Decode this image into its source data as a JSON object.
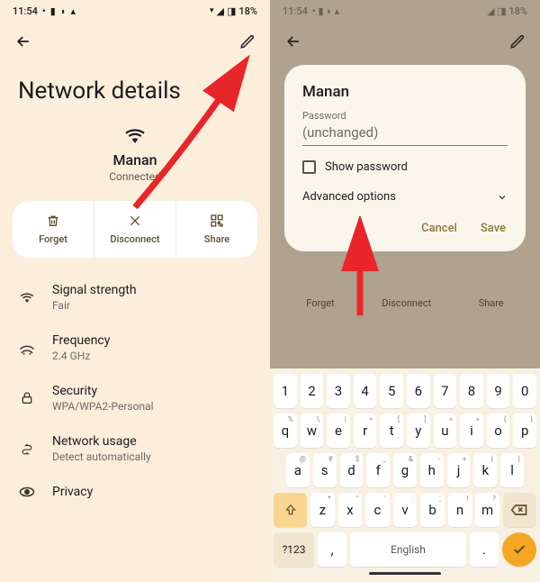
{
  "left": {
    "status": {
      "time": "11:54",
      "battery": "18%"
    },
    "title": "Network details",
    "network": {
      "name": "Manan",
      "status": "Connected"
    },
    "actions": {
      "forget": "Forget",
      "disconnect": "Disconnect",
      "share": "Share"
    },
    "rows": [
      {
        "label": "Signal strength",
        "sub": "Fair"
      },
      {
        "label": "Frequency",
        "sub": "2.4 GHz"
      },
      {
        "label": "Security",
        "sub": "WPA/WPA2-Personal"
      },
      {
        "label": "Network usage",
        "sub": "Detect automatically"
      },
      {
        "label": "Privacy",
        "sub": ""
      }
    ]
  },
  "right": {
    "dialog": {
      "name": "Manan",
      "pw_label": "Password",
      "pw_value": "(unchanged)",
      "showpw": "Show password",
      "advanced": "Advanced options",
      "cancel": "Cancel",
      "save": "Save"
    },
    "behind": {
      "forget": "Forget",
      "disconnect": "Disconnect",
      "share": "Share"
    },
    "keyboard": {
      "row1": [
        "1",
        "2",
        "3",
        "4",
        "5",
        "6",
        "7",
        "8",
        "9",
        "0"
      ],
      "row2": [
        [
          "q",
          "%"
        ],
        [
          "w",
          "\\"
        ],
        [
          "e",
          "|"
        ],
        [
          "r",
          "="
        ],
        [
          "t",
          "["
        ],
        [
          "y",
          "]"
        ],
        [
          "u",
          "<"
        ],
        [
          "i",
          ">"
        ],
        [
          "o",
          "{"
        ],
        [
          "p",
          "}"
        ]
      ],
      "row3": [
        [
          "a",
          "@"
        ],
        [
          "s",
          "#"
        ],
        [
          "d",
          "$"
        ],
        [
          "f",
          "_"
        ],
        [
          "g",
          "&"
        ],
        [
          "h",
          "-"
        ],
        [
          "j",
          "+"
        ],
        [
          "k",
          "("
        ],
        [
          "l",
          ")"
        ]
      ],
      "row4": [
        [
          "z",
          "*"
        ],
        [
          "x",
          "\""
        ],
        [
          "c",
          "'"
        ],
        [
          "v",
          ":"
        ],
        [
          "b",
          ";"
        ],
        [
          "n",
          "!"
        ],
        [
          "m",
          "?"
        ]
      ],
      "sym": "?123",
      "space": "English"
    }
  }
}
